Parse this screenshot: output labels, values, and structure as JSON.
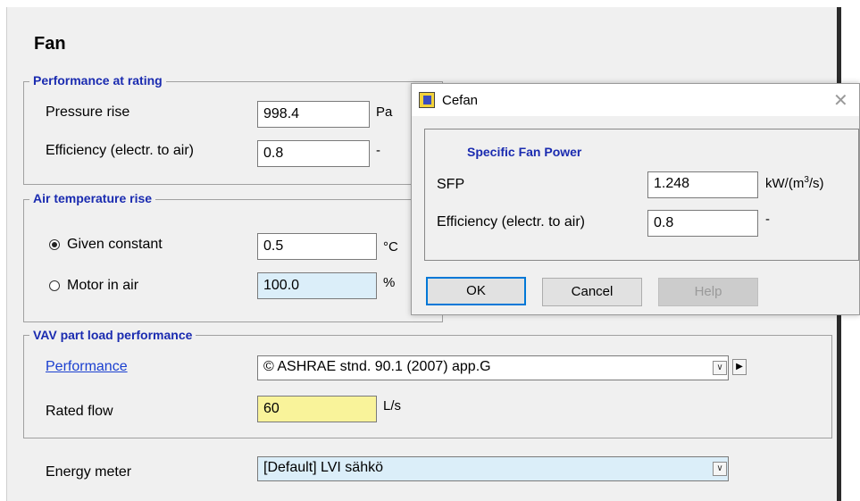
{
  "fan": {
    "title": "Fan",
    "performance_at_rating": {
      "legend": "Performance at rating",
      "pressure_rise_label": "Pressure rise",
      "pressure_rise_value": "998.4",
      "pressure_rise_unit": "Pa",
      "efficiency_label": "Efficiency (electr. to air)",
      "efficiency_value": "0.8",
      "efficiency_unit": "-"
    },
    "air_temperature_rise": {
      "legend": "Air temperature rise",
      "given_constant_label": "Given constant",
      "given_constant_value": "0.5",
      "given_constant_unit": "°C",
      "given_constant_selected": true,
      "motor_in_air_label": "Motor in air",
      "motor_in_air_value": "100.0",
      "motor_in_air_unit": "%",
      "motor_in_air_selected": false
    },
    "vav_part_load": {
      "legend": "VAV part load performance",
      "performance_link": "Performance",
      "performance_value": "© ASHRAE stnd. 90.1 (2007) app.G",
      "rated_flow_label": "Rated flow",
      "rated_flow_value": "60",
      "rated_flow_unit": "L/s"
    },
    "energy_meter": {
      "label": "Energy meter",
      "value": "[Default] LVI sähkö"
    }
  },
  "dialog": {
    "title": "Cefan",
    "close_icon": "close-icon",
    "group_legend": "Specific Fan Power",
    "sfp_label": "SFP",
    "sfp_value": "1.248",
    "sfp_unit_base": "kW/(m",
    "sfp_unit_sup": "3",
    "sfp_unit_end": "/s)",
    "efficiency_label": "Efficiency (electr. to air)",
    "efficiency_value": "0.8",
    "efficiency_unit": "-",
    "ok_label": "OK",
    "cancel_label": "Cancel",
    "help_label": "Help"
  },
  "colors": {
    "legend_blue": "#1a2bb0",
    "link_blue": "#1a3fd0",
    "readonly_field": "#dbeef9",
    "highlight_field": "#f9f39a",
    "default_button_border": "#0078d7"
  }
}
